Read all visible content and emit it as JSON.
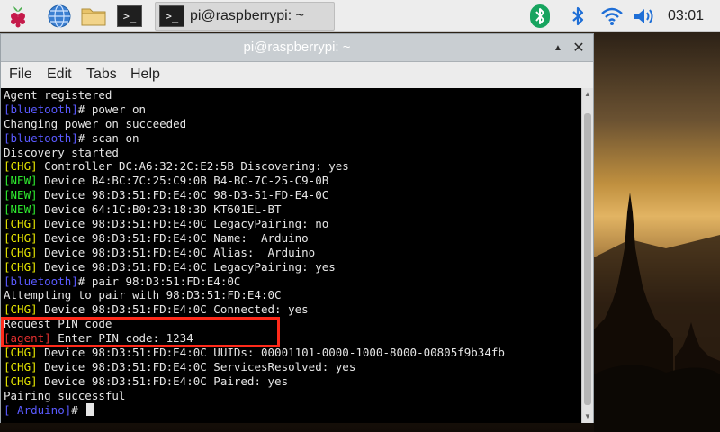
{
  "taskbar": {
    "icons": [
      "raspberry-menu-icon",
      "web-browser-icon",
      "file-manager-icon",
      "terminal-icon"
    ],
    "task": {
      "label": "pi@raspberrypi: ~",
      "icon": "terminal-icon"
    },
    "tray": [
      "bluetooth-active-icon",
      "bluetooth-icon",
      "wifi-icon",
      "volume-icon"
    ],
    "clock": "03:01"
  },
  "window": {
    "title": "pi@raspberrypi: ~",
    "menu": [
      "File",
      "Edit",
      "Tabs",
      "Help"
    ]
  },
  "terminal": {
    "lines": [
      {
        "tag": "",
        "text": "Agent registered"
      },
      {
        "tag": "[bluetooth]",
        "tag_type": "prompt",
        "text": "# power on"
      },
      {
        "tag": "",
        "text": "Changing power on succeeded"
      },
      {
        "tag": "[bluetooth]",
        "tag_type": "prompt",
        "text": "# scan on"
      },
      {
        "tag": "",
        "text": "Discovery started"
      },
      {
        "tag": "[CHG]",
        "tag_type": "chg",
        "text": " Controller DC:A6:32:2C:E2:5B Discovering: yes"
      },
      {
        "tag": "[NEW]",
        "tag_type": "new",
        "text": " Device B4:BC:7C:25:C9:0B B4-BC-7C-25-C9-0B"
      },
      {
        "tag": "[NEW]",
        "tag_type": "new",
        "text": " Device 98:D3:51:FD:E4:0C 98-D3-51-FD-E4-0C"
      },
      {
        "tag": "[NEW]",
        "tag_type": "new",
        "text": " Device 64:1C:B0:23:18:3D KT601EL-BT"
      },
      {
        "tag": "[CHG]",
        "tag_type": "chg",
        "text": " Device 98:D3:51:FD:E4:0C LegacyPairing: no"
      },
      {
        "tag": "[CHG]",
        "tag_type": "chg",
        "text": " Device 98:D3:51:FD:E4:0C Name:  Arduino"
      },
      {
        "tag": "[CHG]",
        "tag_type": "chg",
        "text": " Device 98:D3:51:FD:E4:0C Alias:  Arduino"
      },
      {
        "tag": "[CHG]",
        "tag_type": "chg",
        "text": " Device 98:D3:51:FD:E4:0C LegacyPairing: yes"
      },
      {
        "tag": "[bluetooth]",
        "tag_type": "prompt",
        "text": "# pair 98:D3:51:FD:E4:0C"
      },
      {
        "tag": "",
        "text": "Attempting to pair with 98:D3:51:FD:E4:0C"
      },
      {
        "tag": "[CHG]",
        "tag_type": "chg",
        "text": " Device 98:D3:51:FD:E4:0C Connected: yes"
      },
      {
        "tag": "",
        "text": "Request PIN code"
      },
      {
        "tag": "[agent]",
        "tag_type": "agent",
        "text": " Enter PIN code: 1234"
      },
      {
        "tag": "[CHG]",
        "tag_type": "chg",
        "text": " Device 98:D3:51:FD:E4:0C UUIDs: 00001101-0000-1000-8000-00805f9b34fb"
      },
      {
        "tag": "[CHG]",
        "tag_type": "chg",
        "text": " Device 98:D3:51:FD:E4:0C ServicesResolved: yes"
      },
      {
        "tag": "[CHG]",
        "tag_type": "chg",
        "text": " Device 98:D3:51:FD:E4:0C Paired: yes"
      },
      {
        "tag": "",
        "text": "Pairing successful"
      },
      {
        "tag": "[ Arduino]",
        "tag_type": "prompt",
        "text": "# "
      }
    ]
  },
  "colors": {
    "prompt": "#5a5aff",
    "chg": "#e6e600",
    "new": "#2ee82e",
    "agent": "#e63030",
    "highlight": "#ff2a1a"
  }
}
